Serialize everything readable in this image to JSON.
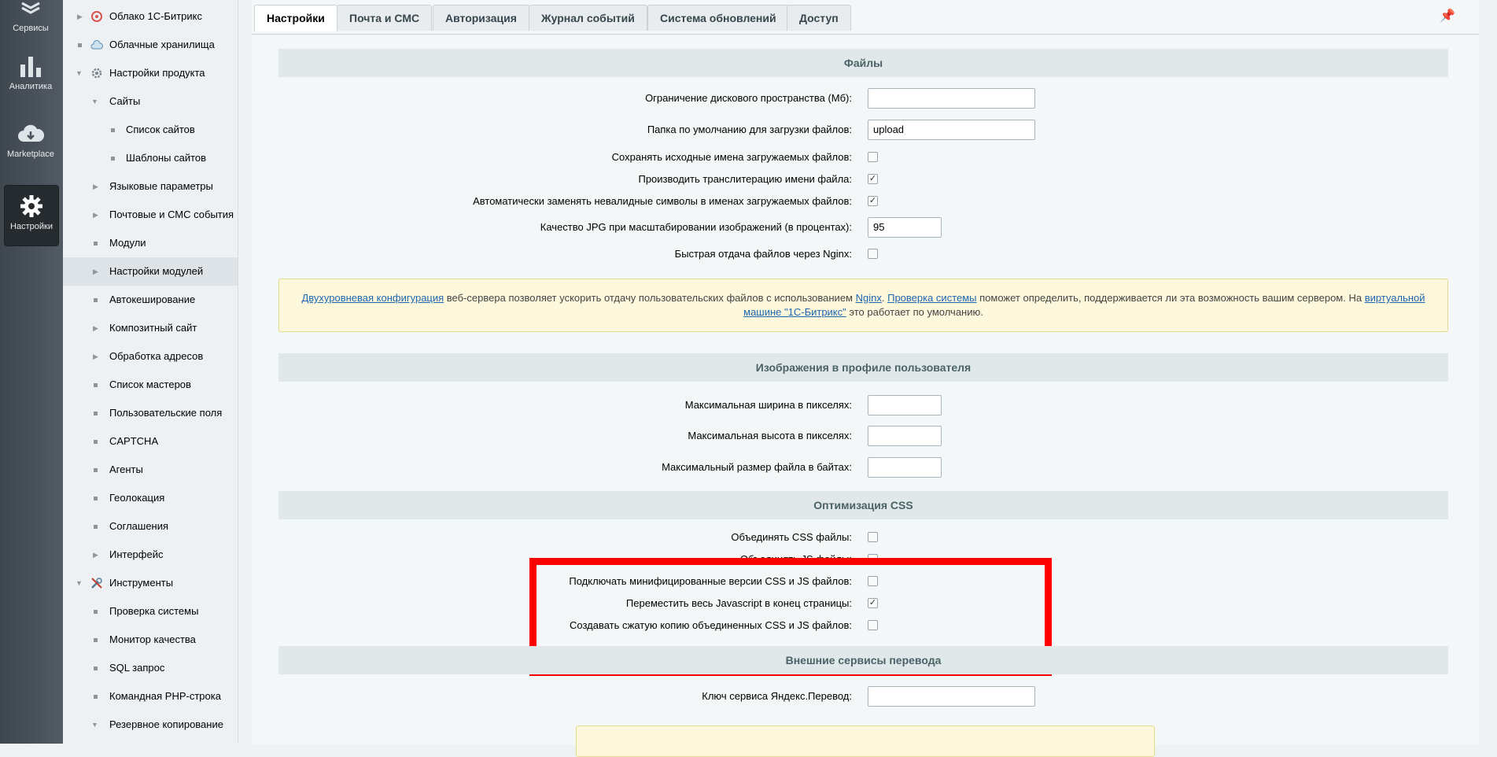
{
  "leftbar": {
    "items": [
      {
        "label": "Сервисы",
        "icon": "services-icon"
      },
      {
        "label": "Аналитика",
        "icon": "analytics-icon"
      },
      {
        "label": "Marketplace",
        "icon": "marketplace-icon"
      },
      {
        "label": "Настройки",
        "icon": "settings-gear-icon"
      }
    ]
  },
  "menu": {
    "items": [
      {
        "label": "Облако 1С-Битрикс"
      },
      {
        "label": "Облачные хранилища"
      },
      {
        "label": "Настройки продукта"
      },
      {
        "label": "Сайты"
      },
      {
        "label": "Список сайтов"
      },
      {
        "label": "Шаблоны сайтов"
      },
      {
        "label": "Языковые параметры"
      },
      {
        "label": "Почтовые и СМС события"
      },
      {
        "label": "Модули"
      },
      {
        "label": "Настройки модулей"
      },
      {
        "label": "Автокеширование"
      },
      {
        "label": "Композитный сайт"
      },
      {
        "label": "Обработка адресов"
      },
      {
        "label": "Список мастеров"
      },
      {
        "label": "Пользовательские поля"
      },
      {
        "label": "CAPTCHA"
      },
      {
        "label": "Агенты"
      },
      {
        "label": "Геолокация"
      },
      {
        "label": "Соглашения"
      },
      {
        "label": "Интерфейс"
      },
      {
        "label": "Инструменты"
      },
      {
        "label": "Проверка системы"
      },
      {
        "label": "Монитор качества"
      },
      {
        "label": "SQL запрос"
      },
      {
        "label": "Командная PHP-строка"
      },
      {
        "label": "Резервное копирование"
      }
    ]
  },
  "tabs": [
    {
      "label": "Настройки"
    },
    {
      "label": "Почта и СМС"
    },
    {
      "label": "Авторизация"
    },
    {
      "label": "Журнал событий"
    },
    {
      "label": "Система обновлений"
    },
    {
      "label": "Доступ"
    }
  ],
  "files": {
    "title": "Файлы",
    "disk_limit_label": "Ограничение дискового пространства (Мб):",
    "disk_limit_value": "",
    "upload_folder_label": "Папка по умолчанию для загрузки файлов:",
    "upload_folder_value": "upload",
    "keep_names_label": "Сохранять исходные имена загружаемых файлов:",
    "keep_names_checked": false,
    "translit_label": "Производить транслитерацию имени файла:",
    "translit_checked": true,
    "replace_invalid_label": "Автоматически заменять невалидные символы в именах загружаемых файлов:",
    "replace_invalid_checked": true,
    "jpg_quality_label": "Качество JPG при масштабировании изображений (в процентах):",
    "jpg_quality_value": "95",
    "nginx_label": "Быстрая отдача файлов через Nginx:",
    "nginx_checked": false
  },
  "note1": {
    "link1": "Двухуровневая конфигурация",
    "text1": " веб-сервера позволяет ускорить отдачу пользовательских файлов с использованием ",
    "link2": "Nginx",
    "text2": ". ",
    "link3": "Проверка системы",
    "text3": " поможет определить, поддерживается ли эта возможность вашим сервером. На ",
    "link4": "виртуальной машине \"1С-Битрикс\"",
    "text4": " это работает по умолчанию."
  },
  "profile_images": {
    "title": "Изображения в профиле пользователя",
    "max_width_label": "Максимальная ширина в пикселях:",
    "max_height_label": "Максимальная высота в пикселях:",
    "max_size_label": "Максимальный размер файла в байтах:"
  },
  "css_opt": {
    "title": "Оптимизация CSS",
    "combine_css_label": "Объединять CSS файлы:",
    "combine_css_checked": false,
    "combine_js_label": "Объединять JS файлы:",
    "combine_js_checked": false,
    "minified_label": "Подключать минифицированные версии CSS и JS файлов:",
    "minified_checked": false,
    "move_js_label": "Переместить весь Javascript в конец страницы:",
    "move_js_checked": true,
    "compress_label": "Создавать сжатую копию объединенных CSS и JS файлов:",
    "compress_checked": false
  },
  "translation": {
    "title": "Внешние сервисы перевода",
    "yandex_key_label": "Ключ сервиса Яндекс.Перевод:",
    "yandex_key_value": ""
  },
  "colors": {
    "highlight": "#ff0000",
    "link": "#2067b0"
  }
}
